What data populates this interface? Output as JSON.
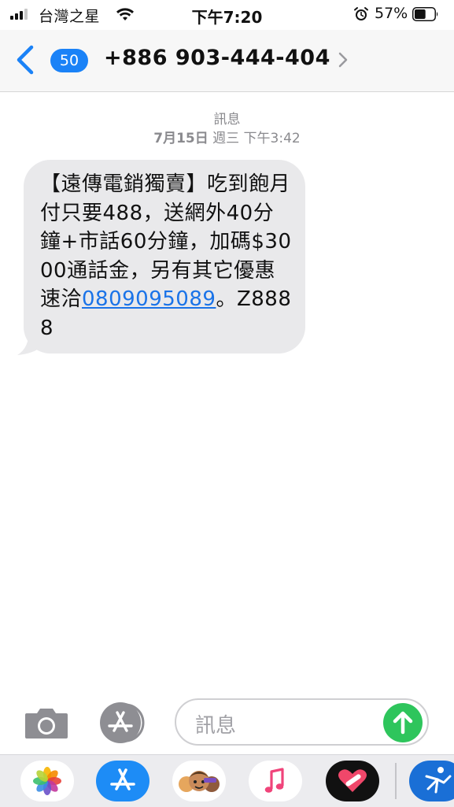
{
  "status_bar": {
    "carrier": "台灣之星",
    "time": "下午7:20",
    "battery_percent": "57%",
    "battery_level": 0.57,
    "signal_bars": 3,
    "icons": [
      "signal-icon",
      "wifi-icon",
      "alarm-icon",
      "battery-icon"
    ]
  },
  "nav": {
    "back_badge": "50",
    "contact": "+886 903-444-404"
  },
  "conversation": {
    "service": "訊息",
    "date": "7月15日",
    "weekday_time": "週三 下午3:42",
    "message": {
      "text_before_link": "【遠傳電銷獨賣】吃到飽月付只要488，送網外40分鐘+市話60分鐘，加碼$3000通話金，另有其它優惠速洽",
      "link": "0809095089",
      "text_after_link": "。Z8888"
    }
  },
  "input_bar": {
    "placeholder": "訊息",
    "icons": [
      "camera-icon",
      "app-store-icon",
      "send-arrow-icon"
    ]
  },
  "app_drawer": {
    "apps": [
      "photos-app-icon",
      "app-store-app-icon",
      "memoji-app-icon",
      "music-app-icon",
      "heart-app-icon",
      "fitness-app-icon"
    ]
  },
  "colors": {
    "accent_blue": "#1a82f7",
    "link_blue": "#1a73e8",
    "send_green": "#2ec55c",
    "bubble_gray": "#e9e9eb",
    "nav_bg": "#f7f7f7"
  }
}
